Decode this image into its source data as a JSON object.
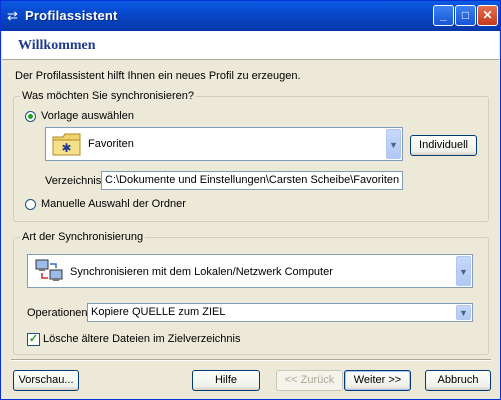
{
  "window": {
    "title": "Profilassistent"
  },
  "header": {
    "title": "Willkommen"
  },
  "intro": "Der Profilassistent hilft Ihnen ein neues Profil zu erzeugen.",
  "sync_group": {
    "legend": "Was möchten Sie synchronisieren?",
    "template_radio": {
      "label": "Vorlage auswählen",
      "checked": true
    },
    "template_combo": {
      "value": "Favoriten"
    },
    "custom_button": "Individuell",
    "directory": {
      "label": "Verzeichnis",
      "value": "C:\\Dokumente und Einstellungen\\Carsten Scheibe\\Favoriten"
    },
    "manual_radio": {
      "label": "Manuelle Auswahl der Ordner",
      "checked": false
    }
  },
  "sync_type_group": {
    "legend": "Art der Synchronisierung",
    "type_combo": {
      "value": "Synchronisieren mit dem Lokalen/Netzwerk Computer"
    },
    "operations": {
      "label": "Operationen",
      "value": "Kopiere QUELLE zum ZIEL"
    },
    "delete_checkbox": {
      "label": "Lösche ältere Dateien im Zielverzeichnis",
      "checked": true
    }
  },
  "buttons": {
    "preview": "Vorschau...",
    "help": "Hilfe",
    "back": "<< Zurück",
    "next": "Weiter >>",
    "cancel": "Abbruch"
  }
}
